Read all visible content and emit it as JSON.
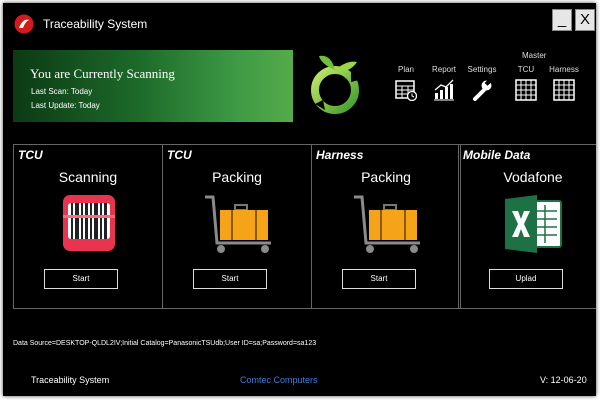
{
  "window": {
    "title": "Traceability System",
    "minimize_label": "_",
    "close_label": "X"
  },
  "status": {
    "title": "You are Currently Scanning",
    "last_scan": "Last Scan: Today",
    "last_update": "Last Update: Today"
  },
  "toolbar": {
    "group_label": "Master",
    "items": [
      {
        "label": "Plan",
        "icon": "calendar-clock-icon"
      },
      {
        "label": "Report",
        "icon": "bar-chart-icon"
      },
      {
        "label": "Settings",
        "icon": "wrench-icon"
      },
      {
        "label": "TCU",
        "icon": "grid-icon"
      },
      {
        "label": "Harness",
        "icon": "grid-icon"
      }
    ]
  },
  "cards": [
    {
      "title": "TCU",
      "subtitle": "Scanning",
      "button": "Start",
      "icon": "barcode-scanner-icon"
    },
    {
      "title": "TCU",
      "subtitle": "Packing",
      "button": "Start",
      "icon": "luggage-cart-icon"
    },
    {
      "title": "Harness",
      "subtitle": "Packing",
      "button": "Start",
      "icon": "luggage-cart-icon"
    },
    {
      "title": "Mobile Data",
      "subtitle": "Vodafone",
      "button": "Uplad",
      "icon": "excel-icon"
    }
  ],
  "connection_string": "Data Source=DESKTOP-QLDL2IV;Initial Catalog=PanasonicTSUdb;User ID=sa;Password=sa123",
  "footer": {
    "app_name": "Traceability System",
    "company": "Comtec Computers",
    "version": "V: 12-06-20"
  },
  "colors": {
    "accent_green": "#3e9a45",
    "link_blue": "#3e7fd9",
    "scanner_red": "#e8344f",
    "luggage_orange": "#f5a319",
    "excel_green": "#1e7145"
  }
}
